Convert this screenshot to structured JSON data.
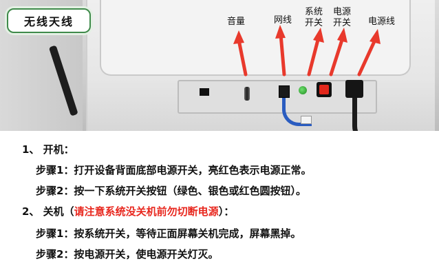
{
  "photo": {
    "title_tag": "无线天线",
    "labels": {
      "volume": "音量",
      "network_cable": "网线",
      "system_switch_line1": "系统",
      "system_switch_line2": "开关",
      "power_switch_line1": "电源",
      "power_switch_line2": "开关",
      "power_cord": "电源线"
    },
    "colors": {
      "arrow": "#e8392c",
      "title_border": "#3f8a4a"
    }
  },
  "instructions": {
    "section1_heading": "1、 开机：",
    "section1_step1": "步骤1：打开设备背面底部电源开关，亮红色表示电源正常。",
    "section1_step2": "步骤2：按一下系统开关按钮（绿色、银色或红色圆按钮）。",
    "section2_heading_prefix": "2、 关机（",
    "section2_heading_warning": "请注意系统没关机前勿切断电源",
    "section2_heading_suffix": "）：",
    "section2_step1": "步骤1：按系统开关，等待正面屏幕关机完成，屏幕黑掉。",
    "section2_step2": "步骤2：按电源开关，使电源开关灯灭。",
    "warning_color": "#e8271e"
  }
}
